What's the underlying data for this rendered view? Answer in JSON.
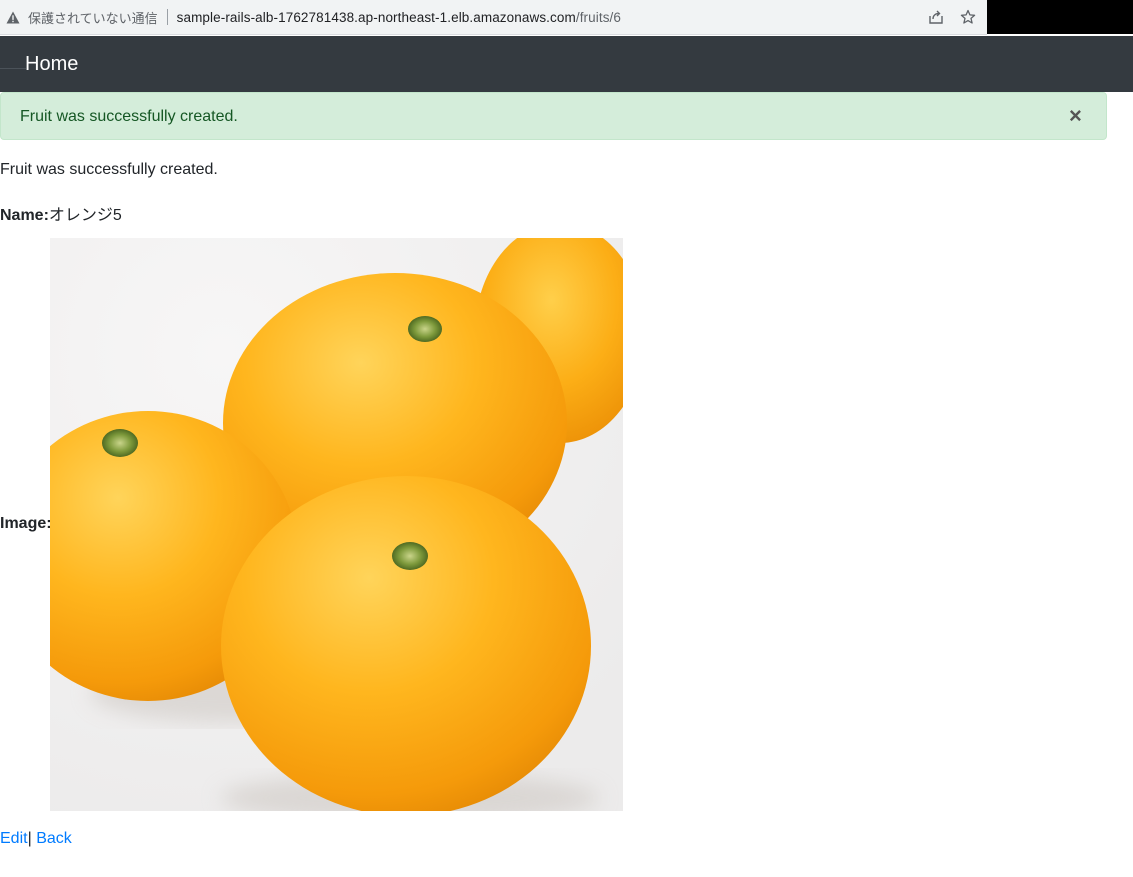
{
  "browser": {
    "security_text": "保護されていない通信",
    "url_host": "sample-rails-alb-1762781438.ap-northeast-1.elb.amazonaws.com",
    "url_path": "/fruits/6",
    "icons": [
      "warning-icon",
      "share-icon",
      "star-icon"
    ]
  },
  "navbar": {
    "brand": "Home",
    "bg_color": "#343a40"
  },
  "alert": {
    "message": "Fruit was successfully created.",
    "close": "×",
    "bg_color": "#d4edda",
    "text_color": "#155724"
  },
  "notice": "Fruit was successfully created.",
  "fruit": {
    "name_label": "Name:",
    "name_value": "オレンジ5",
    "image_label": "Image:"
  },
  "links": {
    "edit": "Edit",
    "separator": "|",
    "back": "Back",
    "color": "#007bff"
  }
}
